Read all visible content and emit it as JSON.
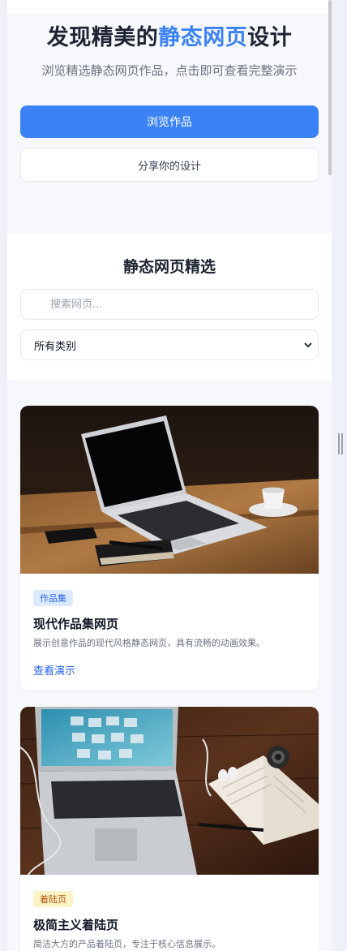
{
  "hero": {
    "title_prefix": "发现精美的",
    "title_accent": "静态网页",
    "title_suffix": "设计",
    "subtitle": "浏览精选静态网页作品，点击即可查看完整演示",
    "primary_button": "浏览作品",
    "secondary_button": "分享你的设计"
  },
  "filters": {
    "title": "静态网页精选",
    "search_placeholder": "搜索网页...",
    "category_selected": "所有类别"
  },
  "cards": [
    {
      "tag": "作品集",
      "title": "现代作品集网页",
      "description": "展示创意作品的现代风格静态网页，具有流畅的动画效果。",
      "link": "查看演示"
    },
    {
      "tag": "着陆页",
      "title": "极简主义着陆页",
      "description": "简洁大方的产品着陆页，专注于核心信息展示。"
    }
  ],
  "colors": {
    "accent": "#3b82f6",
    "tag_blue_bg": "#dbeafe",
    "tag_yellow_bg": "#fef3c7"
  }
}
